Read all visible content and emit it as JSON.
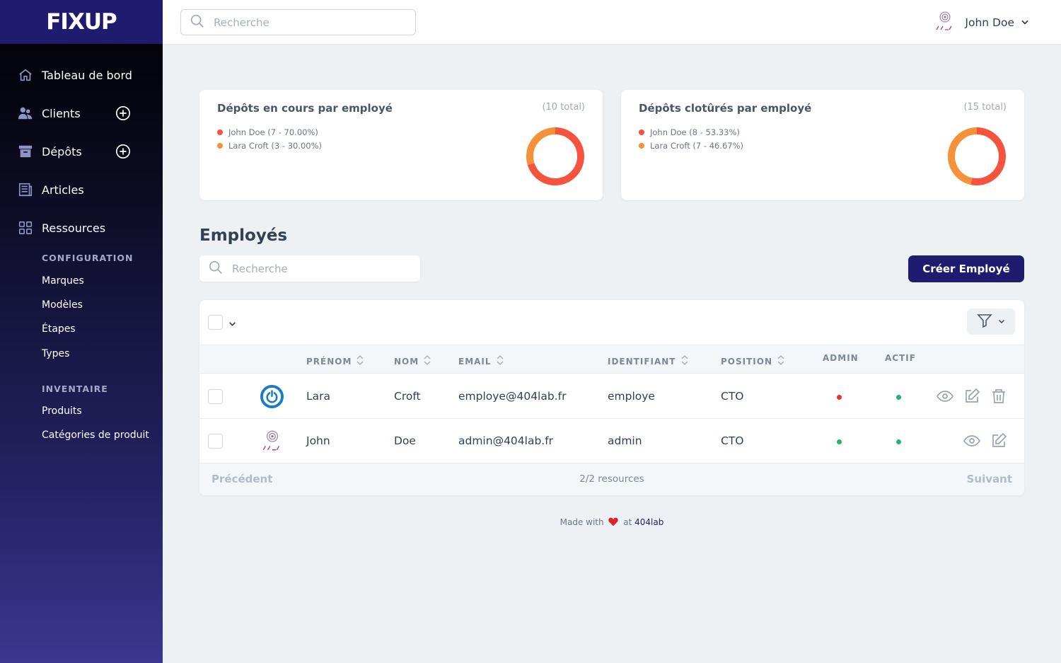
{
  "brand": {
    "name": "FIXUP"
  },
  "sidebar": {
    "items": [
      {
        "label": "Tableau de bord",
        "icon": "home-icon"
      },
      {
        "label": "Clients",
        "icon": "users-icon",
        "add": true
      },
      {
        "label": "Dépôts",
        "icon": "archive-icon",
        "add": true
      },
      {
        "label": "Articles",
        "icon": "newspaper-icon"
      },
      {
        "label": "Ressources",
        "icon": "grid-icon"
      }
    ],
    "configuration": {
      "heading": "CONFIGURATION",
      "items": [
        "Marques",
        "Modèles",
        "Étapes",
        "Types"
      ]
    },
    "inventaire": {
      "heading": "INVENTAIRE",
      "items": [
        "Produits",
        "Catégories de produit"
      ]
    }
  },
  "header": {
    "search_placeholder": "Recherche",
    "user_name": "John Doe"
  },
  "metrics": [
    {
      "title": "Dépôts en cours par employé",
      "total": "(10 total)",
      "legend": [
        "John Doe (7 - 70.00%)",
        "Lara Croft (3 - 30.00%)"
      ],
      "values": [
        7,
        3
      ]
    },
    {
      "title": "Dépôts clotûrés par employé",
      "total": "(15 total)",
      "legend": [
        "John Doe (8 - 53.33%)",
        "Lara Croft (7 - 46.67%)"
      ],
      "values": [
        8,
        7
      ]
    }
  ],
  "colors": {
    "series1": "#f5533d",
    "series2": "#f6913a",
    "brand": "#1f1c70",
    "green": "#21b573",
    "red": "#e3342f"
  },
  "employees": {
    "title": "Employés",
    "search_placeholder": "Recherche",
    "create_label": "Créer Employé",
    "columns": [
      "PRÉNOM",
      "NOM",
      "EMAIL",
      "IDENTIFIANT",
      "POSITION",
      "ADMIN",
      "ACTIF"
    ],
    "rows": [
      {
        "prenom": "Lara",
        "nom": "Croft",
        "email": "employe@404lab.fr",
        "identifiant": "employe",
        "position": "CTO",
        "admin": false,
        "actif": true,
        "avatar": "power-avatar-icon",
        "deletable": true
      },
      {
        "prenom": "John",
        "nom": "Doe",
        "email": "admin@404lab.fr",
        "identifiant": "admin",
        "position": "CTO",
        "admin": true,
        "actif": true,
        "avatar": "404lab-avatar-icon",
        "deletable": false
      }
    ],
    "footer": {
      "prev": "Précédent",
      "count": "2/2 resources",
      "next": "Suivant"
    }
  },
  "page_footer": {
    "made_with": "Made with",
    "at": "at",
    "link": "404lab"
  }
}
